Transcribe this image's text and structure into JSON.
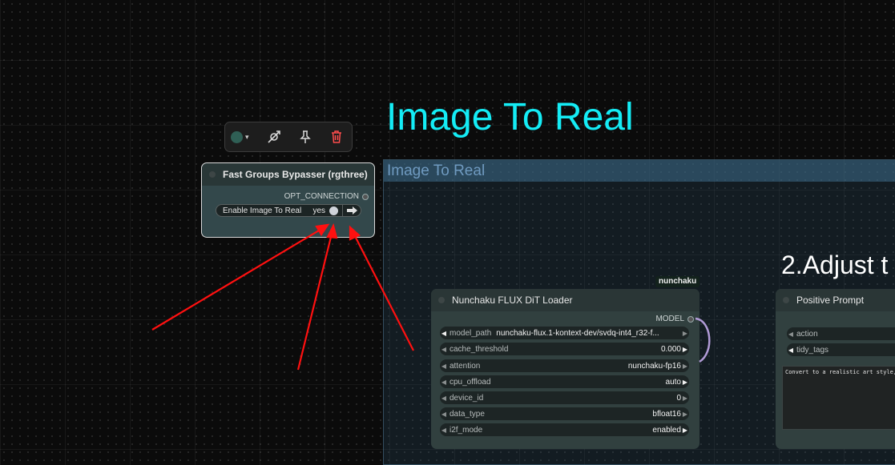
{
  "canvas": {
    "title": "Image To Real",
    "heading_adjust": "2.Adjust t"
  },
  "group": {
    "title": "Image To Real"
  },
  "toolbar": {
    "color": "#2f5f55",
    "icons": [
      "color-picker-icon",
      "bypass-icon",
      "pin-icon",
      "delete-icon"
    ]
  },
  "bypasser_node": {
    "title": "Fast Groups Bypasser (rgthree)",
    "output": "OPT_CONNECTION",
    "toggle": {
      "label": "Enable Image To Real",
      "value": "yes"
    }
  },
  "loader_node": {
    "badge": "nunchaku",
    "title": "Nunchaku FLUX DiT Loader",
    "output": "MODEL",
    "widgets": [
      {
        "name": "model_path",
        "value": "nunchaku-flux.1-kontext-dev/svdq-int4_r32-f..."
      },
      {
        "name": "cache_threshold",
        "value": "0.000"
      },
      {
        "name": "attention",
        "value": "nunchaku-fp16"
      },
      {
        "name": "cpu_offload",
        "value": "auto"
      },
      {
        "name": "device_id",
        "value": "0"
      },
      {
        "name": "data_type",
        "value": "bfloat16"
      },
      {
        "name": "i2f_mode",
        "value": "enabled"
      }
    ]
  },
  "prompt_node": {
    "title": "Positive Prompt",
    "widgets": [
      {
        "name": "action"
      },
      {
        "name": "tidy_tags"
      }
    ],
    "text": "Convert to a realistic art style,"
  },
  "colors": {
    "title_cyan": "#14ecf5",
    "annotation_red": "#ff1010",
    "link_purple": "#b09ad6"
  }
}
